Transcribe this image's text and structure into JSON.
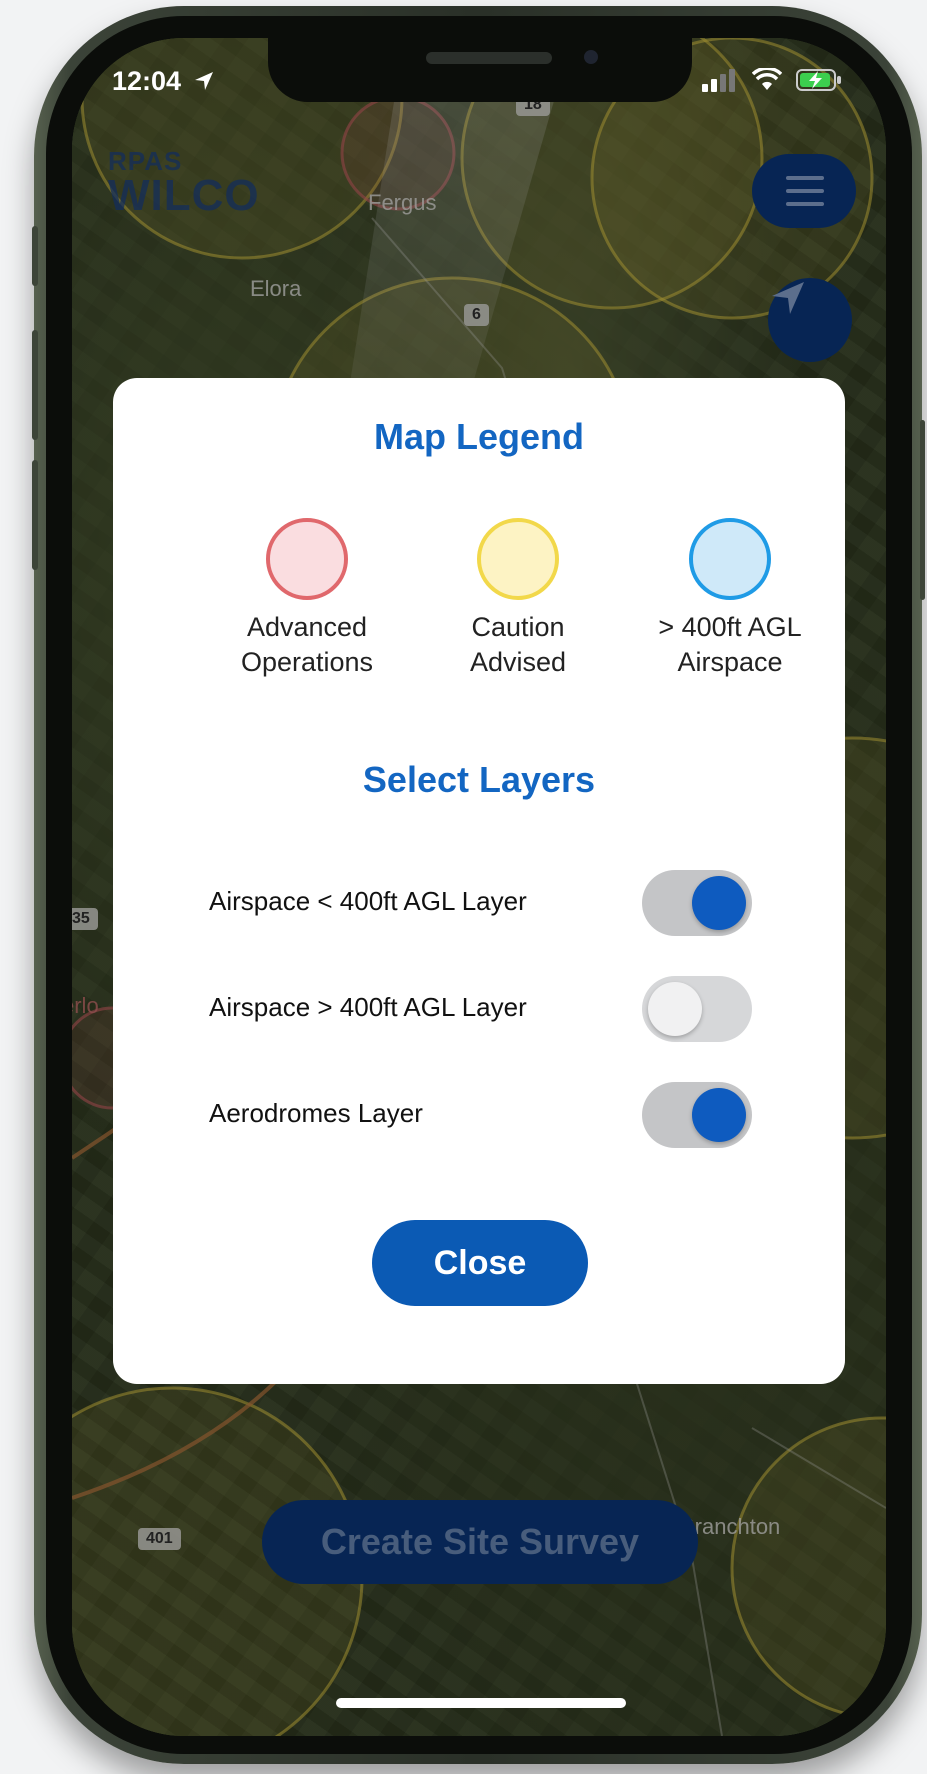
{
  "status_bar": {
    "time": "12:04",
    "icons": [
      "location-arrow-icon",
      "signal-bars-icon",
      "wifi-icon",
      "battery-charging-icon"
    ]
  },
  "map": {
    "logo_line1": "RPAS",
    "logo_line2": "WILCO",
    "labels": {
      "fergus": "Fergus",
      "elora": "Elora",
      "branchton": "Branchton",
      "erin_partial": "erlo"
    },
    "road_shields": {
      "hwy6": "6",
      "hwy401": "401",
      "road35": "35",
      "road18": "18"
    },
    "menu_icon": "hamburger-menu-icon",
    "locate_icon": "navigation-arrow-icon",
    "create_survey_label": "Create Site Survey",
    "zone_colors": {
      "caution": "#f2d84a",
      "advanced": "#e0686c",
      "above_400": "#38a6ea"
    }
  },
  "modal": {
    "legend_title": "Map Legend",
    "legend_items": [
      {
        "line1": "Advanced",
        "line2": "Operations",
        "fill": "#fadde0",
        "stroke": "#e0686c"
      },
      {
        "line1": "Caution",
        "line2": "Advised",
        "fill": "#fdf3c4",
        "stroke": "#f2d84a"
      },
      {
        "line1": "> 400ft AGL",
        "line2": "Airspace",
        "fill": "#cfe9f9",
        "stroke": "#1f9be6"
      }
    ],
    "layers_title": "Select Layers",
    "layers": [
      {
        "label": "Airspace < 400ft AGL Layer",
        "enabled": true
      },
      {
        "label": "Airspace > 400ft AGL Layer",
        "enabled": false
      },
      {
        "label": "Aerodromes Layer",
        "enabled": true
      }
    ],
    "close_label": "Close",
    "accent_color": "#1366c2"
  }
}
